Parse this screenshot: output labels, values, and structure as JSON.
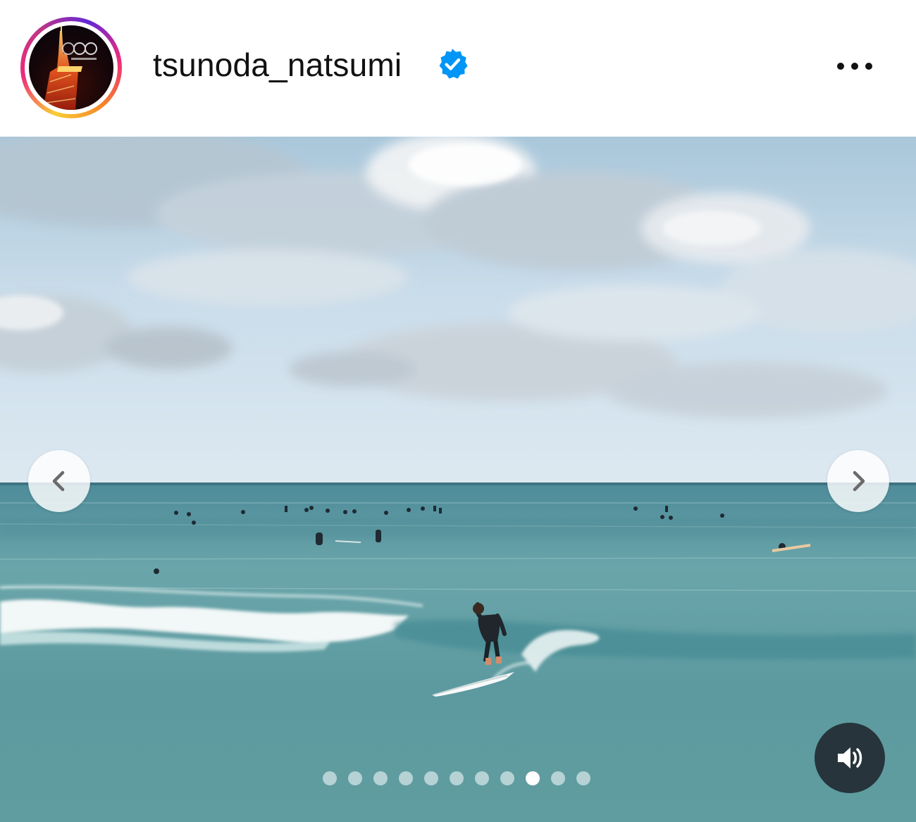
{
  "post": {
    "username": "tsunoda_natsumi",
    "verified": true,
    "avatar_icon": "tokyo-tower-night",
    "menu_icon": "more-horizontal-icon"
  },
  "carousel": {
    "prev_icon": "chevron-left-icon",
    "next_icon": "chevron-right-icon",
    "sound_icon": "speaker-on-icon",
    "slide_count": 11,
    "active_slide": 9
  },
  "colors": {
    "verified_blue": "#0095f6",
    "sky": "#cfe3ef",
    "sea": "#5f9da2",
    "avatar_ring": "#ee2a7b"
  }
}
